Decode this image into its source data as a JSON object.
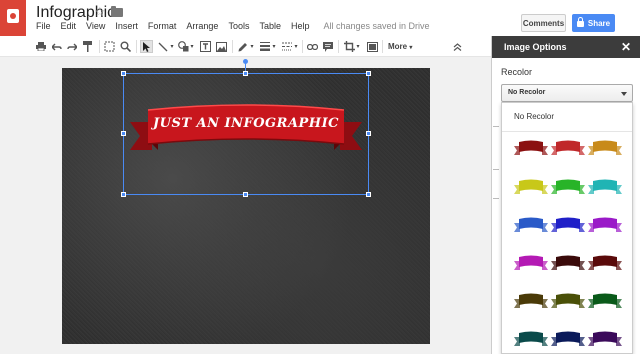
{
  "app": {
    "title": "Infographic",
    "logo_icon": "slides-logo-icon"
  },
  "menubar": {
    "items": [
      "File",
      "Edit",
      "View",
      "Insert",
      "Format",
      "Arrange",
      "Tools",
      "Table",
      "Help"
    ],
    "status": "All changes saved in Drive"
  },
  "header": {
    "comments_label": "Comments",
    "share_label": "Share"
  },
  "toolbar": {
    "more_label": "More",
    "icons": [
      "print-icon",
      "undo-icon",
      "redo-icon",
      "paint-format-icon",
      "zoom-fit-icon",
      "zoom-icon",
      "select-icon",
      "line-icon",
      "shape-icon",
      "textbox-icon",
      "image-icon",
      "pen-color-icon",
      "line-weight-icon",
      "line-dash-icon",
      "link-icon",
      "comment-icon",
      "crop-icon",
      "image-options-icon",
      "collapse-icon"
    ]
  },
  "slide": {
    "banner_text": "JUST AN INFOGRAPHIC",
    "banner_color": "#c8161d"
  },
  "panel": {
    "title": "Image Options",
    "recolor_label": "Recolor",
    "selected": "No Recolor",
    "menu_first_item": "No Recolor",
    "swatches": [
      [
        "#8b1010",
        "#c0282a",
        "#c88a1a"
      ],
      [
        "#c8c819",
        "#28b428",
        "#20b4b4"
      ],
      [
        "#2a5ac8",
        "#2020c8",
        "#9a1ac8"
      ],
      [
        "#b41ab4",
        "#3a0a0a",
        "#5a0a0a"
      ],
      [
        "#4a3a08",
        "#4a5008",
        "#0a5a1a"
      ],
      [
        "#0a4a4a",
        "#0a1a5a",
        "#3a0a5a"
      ]
    ]
  }
}
